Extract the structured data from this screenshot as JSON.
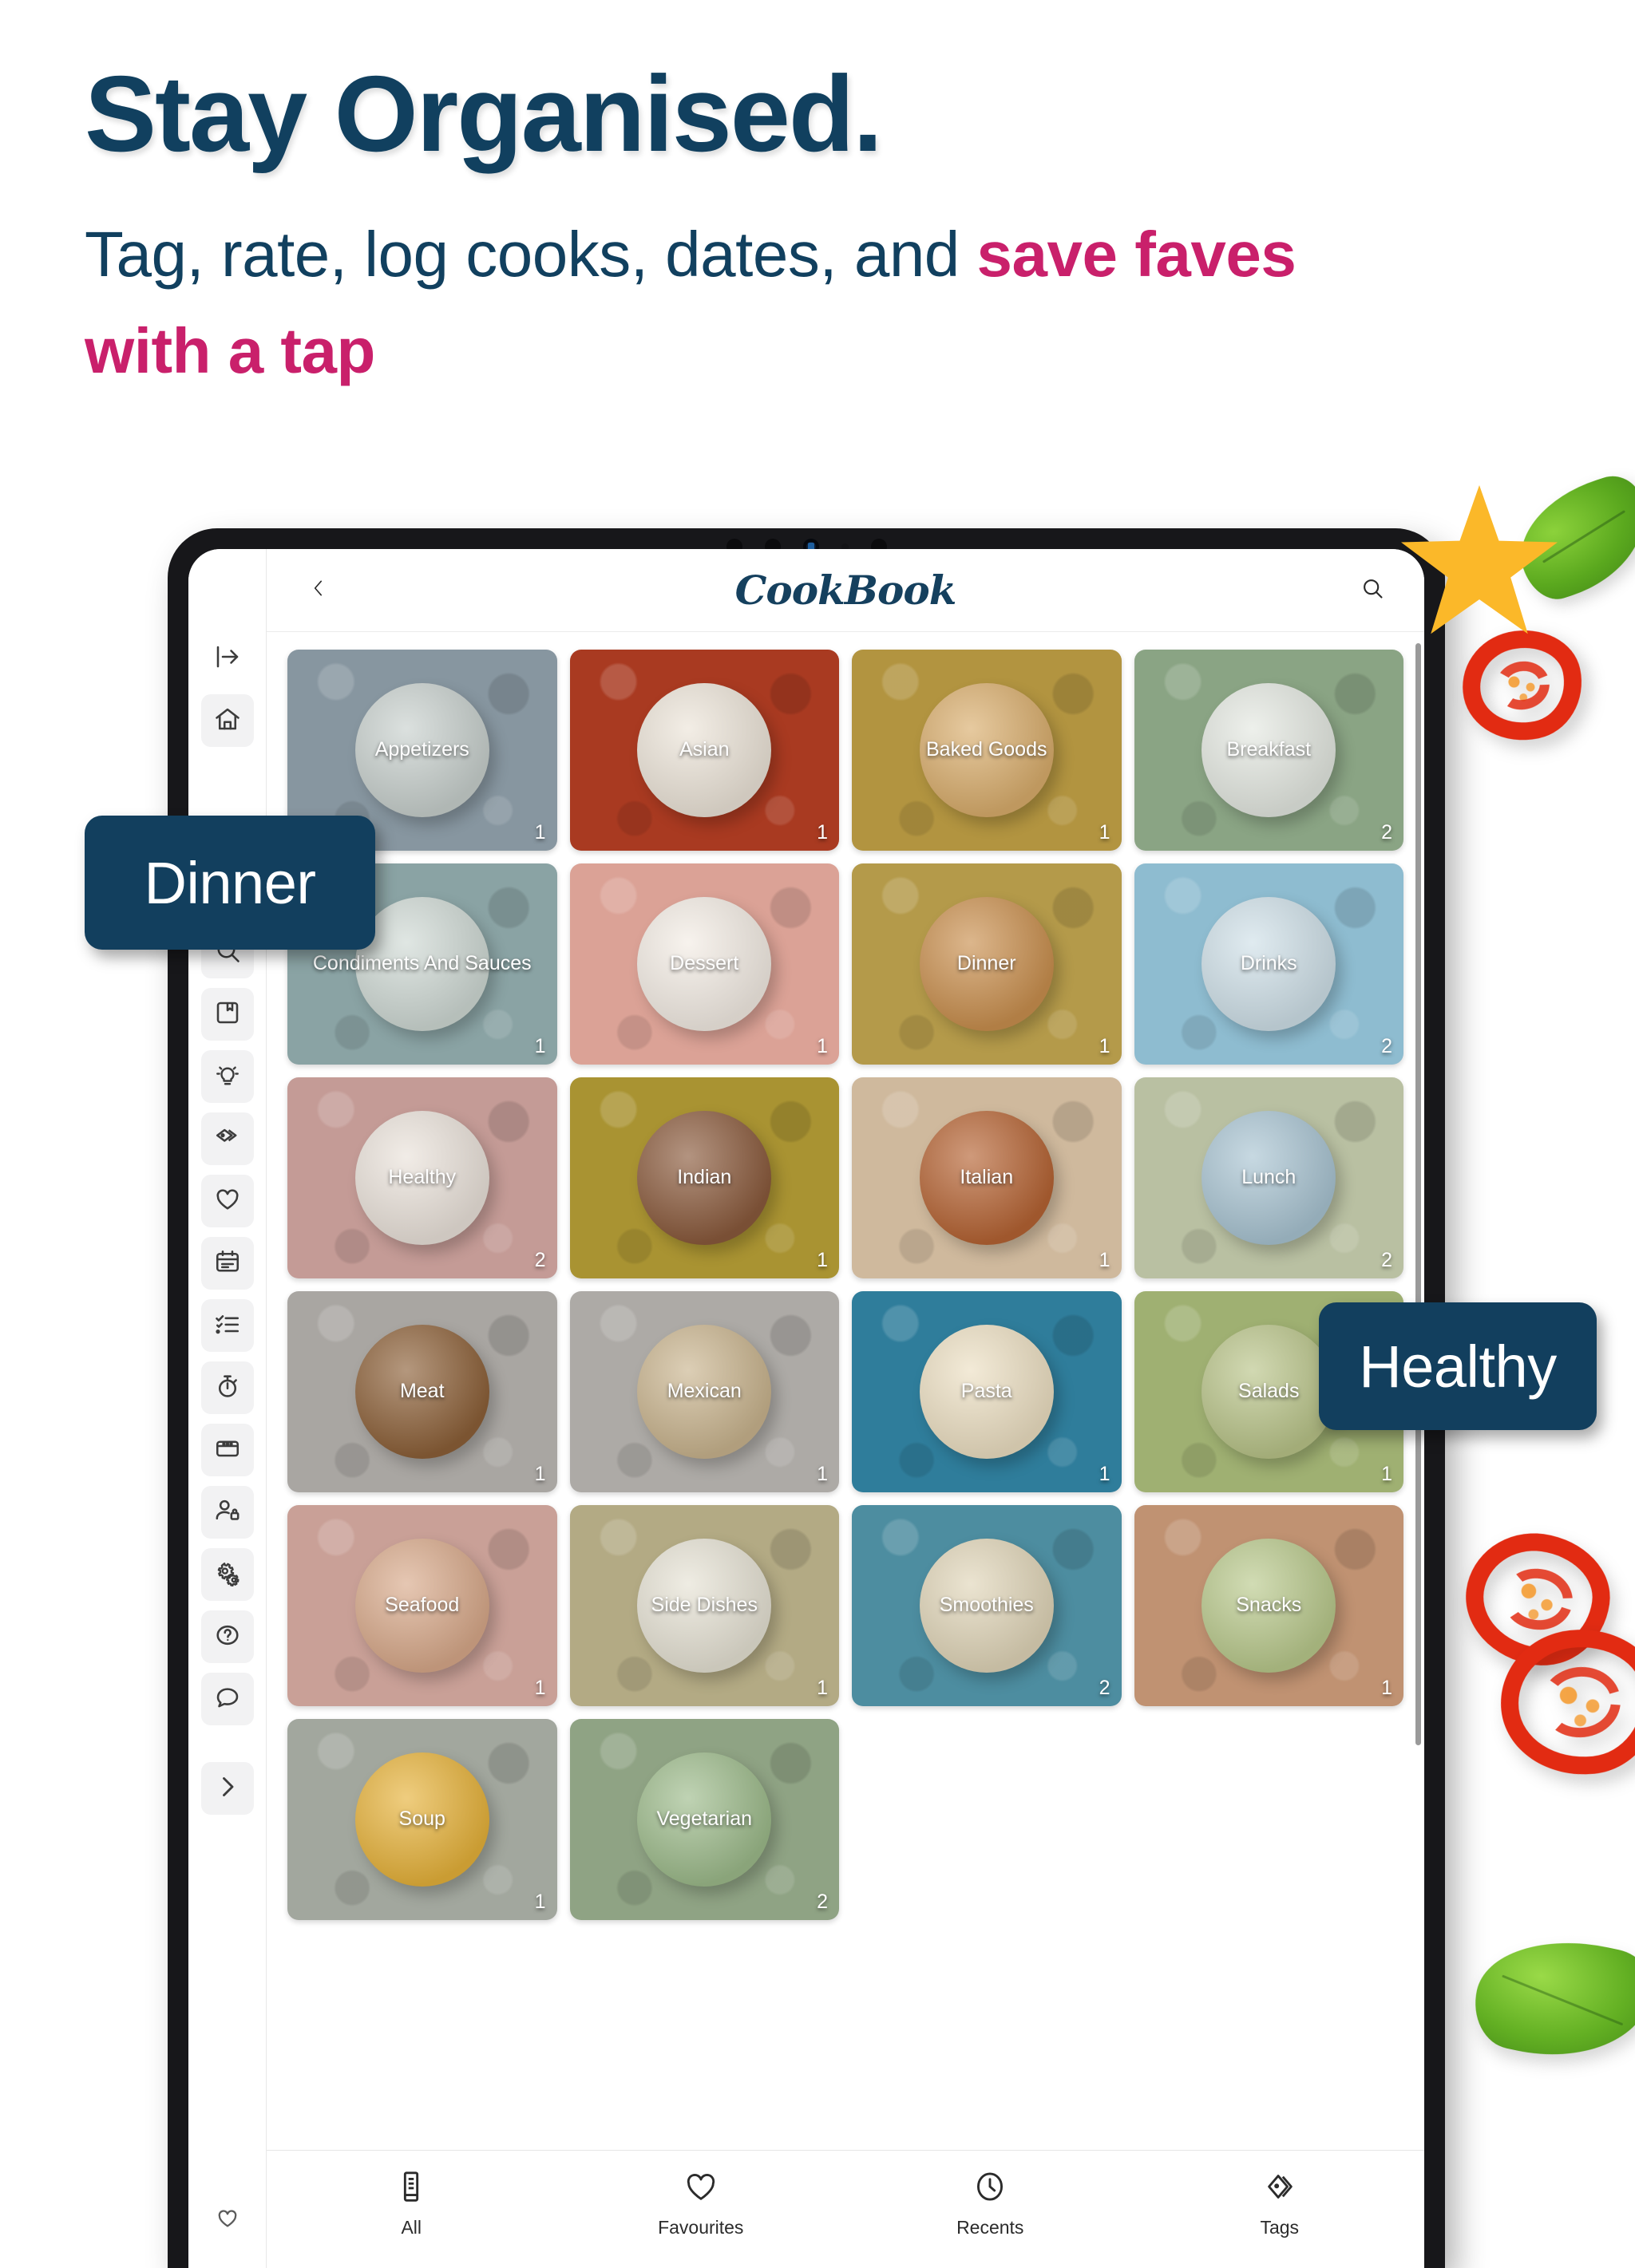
{
  "promo": {
    "headline": "Stay Organised.",
    "subhead_part1": "Tag, rate, log cooks, dates, and ",
    "subhead_accent": "save faves with a tap",
    "accent_color": "#c9206b",
    "navy_color": "#11405f"
  },
  "callouts": [
    {
      "label": "Dinner"
    },
    {
      "label": "Healthy"
    }
  ],
  "app": {
    "brand": "CookBook",
    "topbar": {
      "back_icon": "chevron-left-icon",
      "search_icon": "search-icon"
    },
    "rail": {
      "items": [
        {
          "name": "expand-sidebar",
          "icon": "panel-expand-icon",
          "filled": false
        },
        {
          "name": "home",
          "icon": "home-icon",
          "filled": true
        },
        {
          "name": "search",
          "icon": "search-icon",
          "filled": true
        },
        {
          "name": "recipe-book",
          "icon": "book-icon",
          "filled": true
        },
        {
          "name": "ideas",
          "icon": "lightbulb-icon",
          "filled": true
        },
        {
          "name": "tags",
          "icon": "tag-icon",
          "filled": true
        },
        {
          "name": "favourites",
          "icon": "heart-icon",
          "filled": true
        },
        {
          "name": "meal-planner",
          "icon": "calendar-icon",
          "filled": true
        },
        {
          "name": "shopping-list",
          "icon": "checklist-icon",
          "filled": true
        },
        {
          "name": "timers",
          "icon": "timer-icon",
          "filled": true
        },
        {
          "name": "window",
          "icon": "window-icon",
          "filled": true
        },
        {
          "name": "account-privacy",
          "icon": "user-lock-icon",
          "filled": true
        },
        {
          "name": "settings",
          "icon": "gears-icon",
          "filled": true
        },
        {
          "name": "help",
          "icon": "question-circle-icon",
          "filled": true
        },
        {
          "name": "feedback",
          "icon": "chat-bubble-icon",
          "filled": true
        },
        {
          "name": "expand-more",
          "icon": "chevron-right-icon",
          "filled": true
        }
      ],
      "bottom_icon": "heart-outline-icon"
    },
    "categories": [
      {
        "label": "Appetizers",
        "count": "1",
        "bg": "#8796a0",
        "plate": "#c8d0cd"
      },
      {
        "label": "Asian",
        "count": "1",
        "bg": "#a93a21",
        "plate": "#ece4d8"
      },
      {
        "label": "Baked Goods",
        "count": "1",
        "bg": "#b29440",
        "plate": "#d9ad6c"
      },
      {
        "label": "Breakfast",
        "count": "2",
        "bg": "#8aa484",
        "plate": "#e4e8e1"
      },
      {
        "label": "Condiments And Sauces",
        "count": "1",
        "bg": "#8aa3a4",
        "plate": "#cfd9d4"
      },
      {
        "label": "Dessert",
        "count": "1",
        "bg": "#dba296",
        "plate": "#f3ece4"
      },
      {
        "label": "Dinner",
        "count": "1",
        "bg": "#b49a4a",
        "plate": "#c98f4e"
      },
      {
        "label": "Drinks",
        "count": "2",
        "bg": "#8ebcd0",
        "plate": "#cfe0e8"
      },
      {
        "label": "Healthy",
        "count": "2",
        "bg": "#c49b96",
        "plate": "#eae2da"
      },
      {
        "label": "Indian",
        "count": "1",
        "bg": "#a99332",
        "plate": "#8a5a3c"
      },
      {
        "label": "Italian",
        "count": "1",
        "bg": "#cfb99d",
        "plate": "#b56333"
      },
      {
        "label": "Lunch",
        "count": "2",
        "bg": "#b9c0a2",
        "plate": "#a9c4d2"
      },
      {
        "label": "Meat",
        "count": "1",
        "bg": "#a9a6a2",
        "plate": "#8c6038"
      },
      {
        "label": "Mexican",
        "count": "1",
        "bg": "#adaaa6",
        "plate": "#c9b48e"
      },
      {
        "label": "Pasta",
        "count": "1",
        "bg": "#2f7d9b",
        "plate": "#ecdfc2"
      },
      {
        "label": "Salads",
        "count": "1",
        "bg": "#9fb072",
        "plate": "#b9c489"
      },
      {
        "label": "Seafood",
        "count": "1",
        "bg": "#c9a097",
        "plate": "#d8a98a"
      },
      {
        "label": "Side Dishes",
        "count": "1",
        "bg": "#b3aa84",
        "plate": "#e6e2d4"
      },
      {
        "label": "Smoothies",
        "count": "2",
        "bg": "#4d8da0",
        "plate": "#e0d5b8"
      },
      {
        "label": "Snacks",
        "count": "1",
        "bg": "#c09272",
        "plate": "#b9c98c"
      },
      {
        "label": "Soup",
        "count": "1",
        "bg": "#a2a79e",
        "plate": "#e6b23a"
      },
      {
        "label": "Vegetarian",
        "count": "2",
        "bg": "#8fa384",
        "plate": "#9dbb8b"
      }
    ],
    "tabs": [
      {
        "label": "All",
        "icon": "book-page-icon"
      },
      {
        "label": "Favourites",
        "icon": "heart-icon"
      },
      {
        "label": "Recents",
        "icon": "clock-icon"
      },
      {
        "label": "Tags",
        "icon": "tag-icon"
      }
    ]
  }
}
